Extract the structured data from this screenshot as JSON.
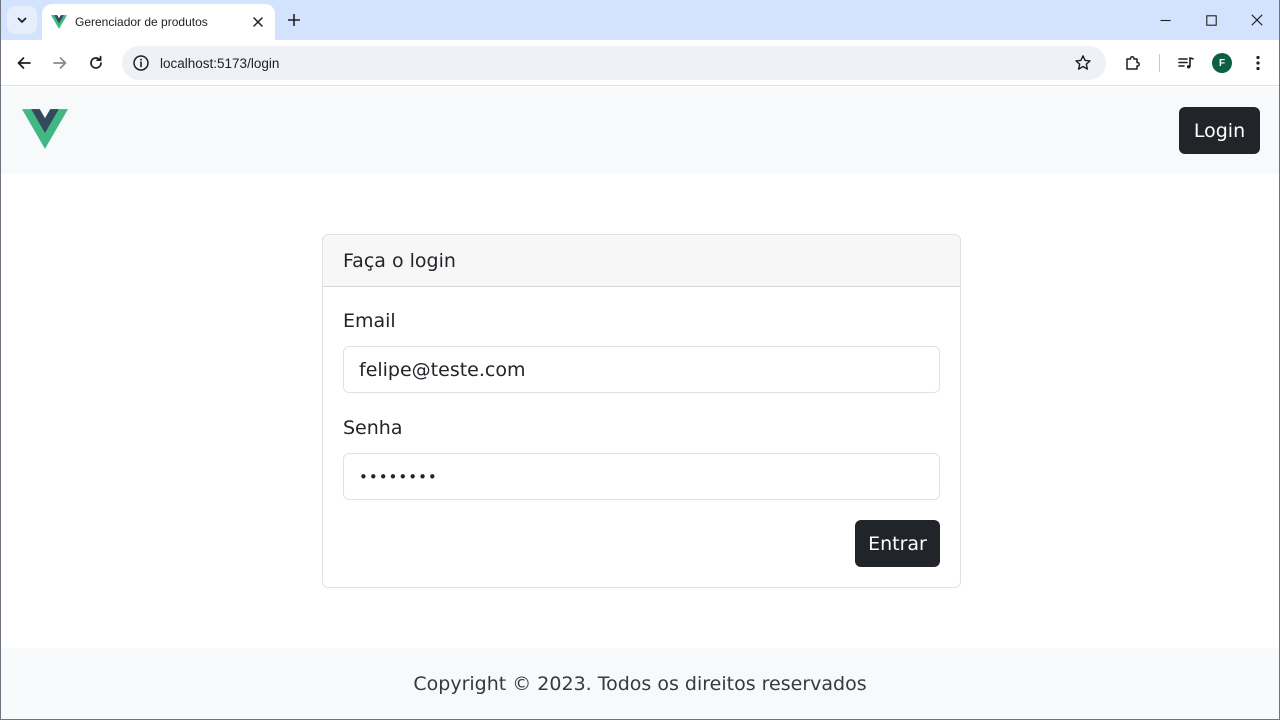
{
  "browser": {
    "tab_title": "Gerenciador de produtos",
    "url": "localhost:5173/login",
    "profile_initial": "F",
    "colors": {
      "tabstrip": "#d3e3fd",
      "profile": "#0b5f43"
    }
  },
  "navbar": {
    "login_label": "Login",
    "logo_colors": {
      "outer": "#41b883",
      "inner": "#35495e"
    }
  },
  "login_card": {
    "header": "Faça o login",
    "email_label": "Email",
    "email_value": "felipe@teste.com",
    "password_label": "Senha",
    "password_value": "••••••••",
    "submit_label": "Entrar"
  },
  "footer": {
    "text": "Copyright © 2023. Todos os direitos reservados"
  }
}
